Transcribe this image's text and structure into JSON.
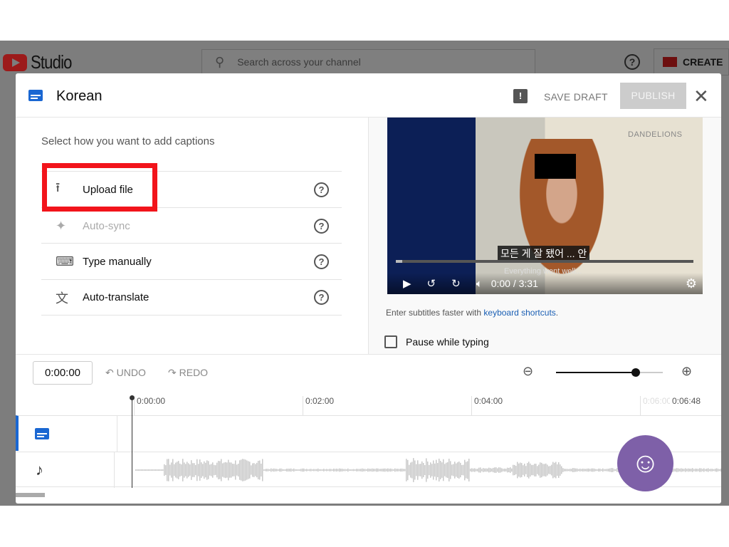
{
  "topbar": {
    "logo_text": "Studio",
    "search_placeholder": "Search across your channel",
    "create_label": "CREATE"
  },
  "dialog": {
    "title": "Korean",
    "save_draft": "SAVE DRAFT",
    "publish": "PUBLISH",
    "close": "✕",
    "prompt": "Select how you want to add captions",
    "options": [
      {
        "label": "Upload file",
        "icon": "upload-icon",
        "enabled": true
      },
      {
        "label": "Auto-sync",
        "icon": "sparkle-icon",
        "enabled": false
      },
      {
        "label": "Type manually",
        "icon": "keyboard-icon",
        "enabled": true
      },
      {
        "label": "Auto-translate",
        "icon": "translate-icon",
        "enabled": true
      }
    ]
  },
  "video": {
    "brand": "DANDELIONS",
    "subtitle_ko": "모든 게 잘 됐어 ... 안",
    "subtitle_en": "Everything went well...",
    "time": "0:00 / 3:31"
  },
  "hint": {
    "text": "Enter subtitles faster with ",
    "link": "keyboard shortcuts",
    "end": "."
  },
  "pause_label": "Pause while typing",
  "timeline": {
    "current": "0:00:00",
    "undo": "UNDO",
    "redo": "REDO",
    "ticks": [
      "0:00:00",
      "0:02:00",
      "0:04:00",
      "0:06:00",
      "0:06:48"
    ],
    "zoom_level": 0.75
  },
  "colors": {
    "accent": "#1a67d2",
    "highlight": "#f2141b",
    "avatar": "#7e60a8"
  }
}
